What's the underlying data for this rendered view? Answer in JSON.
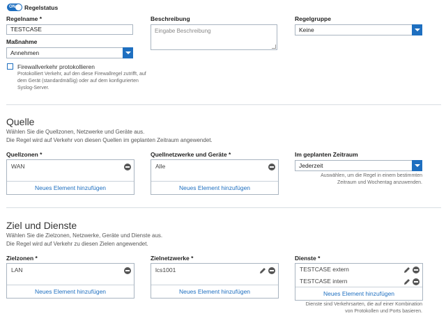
{
  "rule_status": {
    "toggle_text": "ON",
    "label": "Regelstatus"
  },
  "rule_name": {
    "label": "Regelname *",
    "value": "TESTCASE"
  },
  "description": {
    "label": "Beschreibung",
    "placeholder": "Eingabe Beschreibung"
  },
  "rule_group": {
    "label": "Regelgruppe",
    "value": "Keine"
  },
  "action": {
    "label": "Maßnahme",
    "value": "Annehmen"
  },
  "logging": {
    "label": "Firewallverkehr protokollieren",
    "hint_line1": "Protokolliert Verkehr, auf den diese Firewallregel zutrifft, auf",
    "hint_line2": "dem Gerät (standardmäßig) oder auf dem konfigurierten",
    "hint_line3": "Syslog-Server."
  },
  "source": {
    "title": "Quelle",
    "desc_line1": "Wählen Sie die Quellzonen, Netzwerke und Geräte aus.",
    "desc_line2": "Die Regel wird auf Verkehr von diesen Quellen im geplanten Zeitraum angewendet.",
    "zones": {
      "label": "Quellzonen *",
      "items": [
        "WAN"
      ],
      "add": "Neues Element hinzufügen"
    },
    "networks": {
      "label": "Quellnetzwerke und Geräte *",
      "items": [
        "Alle"
      ],
      "add": "Neues Element hinzufügen"
    },
    "schedule": {
      "label": "Im geplanten Zeitraum",
      "value": "Jederzeit",
      "hint_line1": "Auswählen, um die Regel in einem bestimmten",
      "hint_line2": "Zeitraum und Wochentag anzuwenden."
    }
  },
  "destination": {
    "title": "Ziel und Dienste",
    "desc_line1": "Wählen Sie die Zielzonen, Netzwerke, Geräte und Dienste aus.",
    "desc_line2": "Die Regel wird auf Verkehr zu diesen Zielen angewendet.",
    "zones": {
      "label": "Zielzonen *",
      "items": [
        "LAN"
      ],
      "add": "Neues Element hinzufügen"
    },
    "networks": {
      "label": "Zielnetzwerke *",
      "items": [
        "lcs1001"
      ],
      "add": "Neues Element hinzufügen"
    },
    "services": {
      "label": "Dienste *",
      "items": [
        "TESTCASE extern",
        "TESTCASE intern"
      ],
      "add": "Neues Element hinzufügen",
      "hint_line1": "Dienste sind Verkehrsarten, die auf einer Kombination",
      "hint_line2": "von Protokollen und Ports basieren."
    }
  }
}
